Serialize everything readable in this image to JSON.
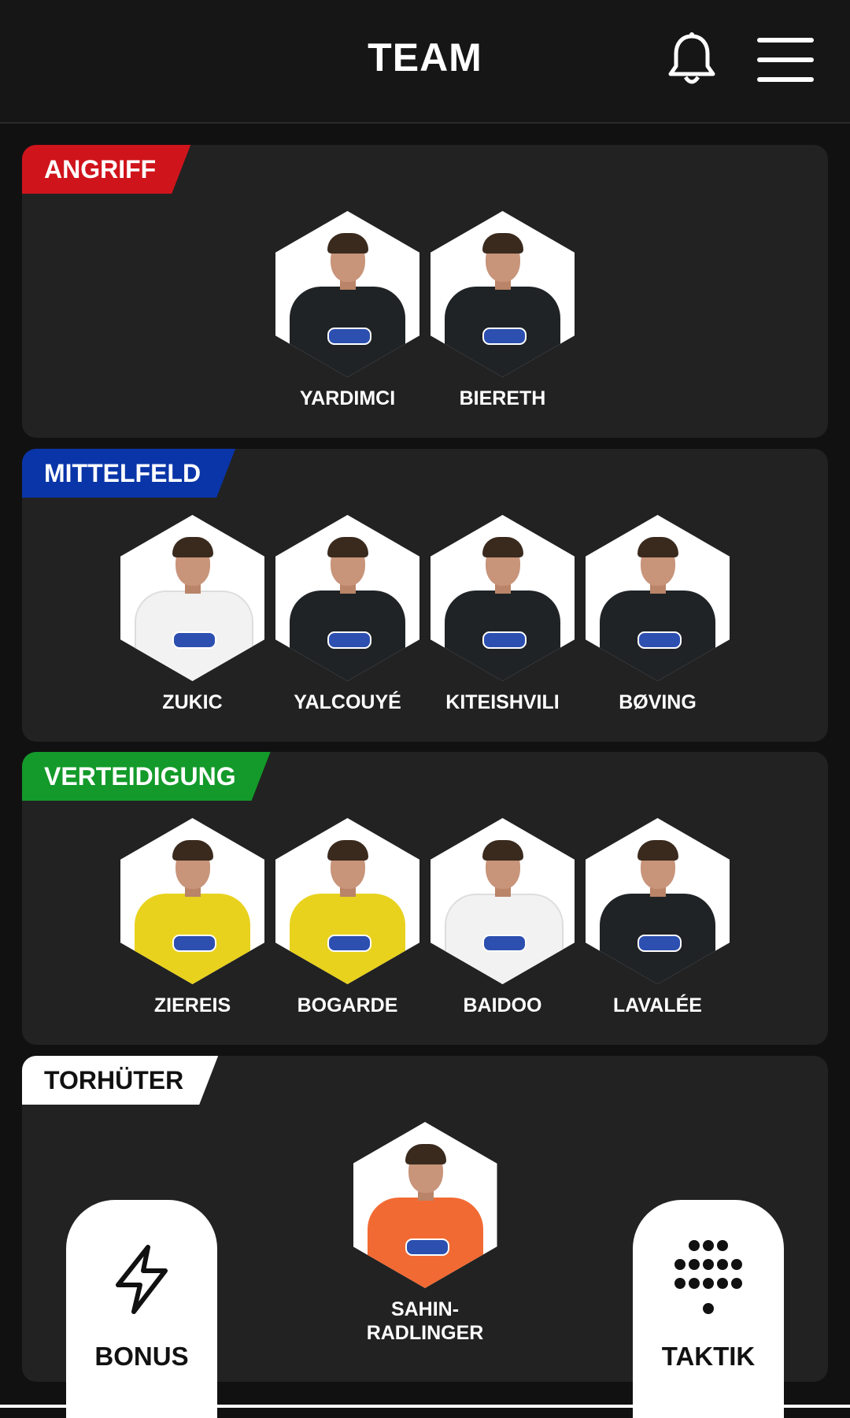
{
  "header": {
    "title": "TEAM"
  },
  "sections": [
    {
      "key": "angriff",
      "label": "ANGRIFF",
      "color": "#d0141c",
      "players": [
        {
          "name": "YARDIMCI",
          "kit": "#1f2326"
        },
        {
          "name": "BIERETH",
          "kit": "#1f2326"
        }
      ]
    },
    {
      "key": "mittelfeld",
      "label": "MITTELFELD",
      "color": "#0a35a8",
      "players": [
        {
          "name": "ZUKIC",
          "kit": "#f2f2f2"
        },
        {
          "name": "YALCOUYÉ",
          "kit": "#1f2326"
        },
        {
          "name": "KITEISHVILI",
          "kit": "#1f2326"
        },
        {
          "name": "BØVING",
          "kit": "#1f2326"
        }
      ]
    },
    {
      "key": "verteidigung",
      "label": "VERTEIDIGUNG",
      "color": "#139a2a",
      "players": [
        {
          "name": "ZIEREIS",
          "kit": "#e8d21e"
        },
        {
          "name": "BOGARDE",
          "kit": "#e8d21e"
        },
        {
          "name": "BAIDOO",
          "kit": "#f2f2f2"
        },
        {
          "name": "LAVALÉE",
          "kit": "#1f2326"
        }
      ]
    },
    {
      "key": "torhueter",
      "label": "TORHÜTER",
      "color": "#ffffff",
      "players": [
        {
          "name": "SAHIN-\nRADLINGER",
          "kit": "#f26a33"
        }
      ]
    }
  ],
  "buttons": {
    "bonus": {
      "label": "BONUS",
      "icon": "lightning-icon"
    },
    "taktik": {
      "label": "TAKTIK",
      "icon": "formation-icon"
    }
  }
}
